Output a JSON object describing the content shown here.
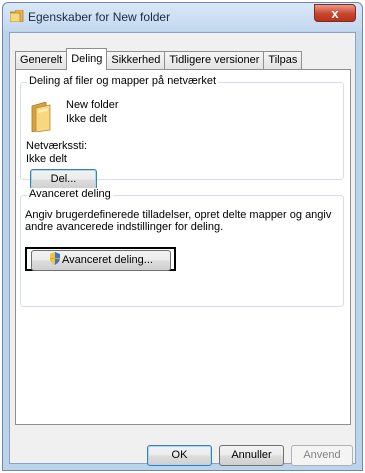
{
  "window": {
    "title": "Egenskaber for New folder",
    "close_glyph": "x"
  },
  "tabs": [
    {
      "label": "Generelt",
      "active": false
    },
    {
      "label": "Deling",
      "active": true
    },
    {
      "label": "Sikkerhed",
      "active": false
    },
    {
      "label": "Tidligere versioner",
      "active": false
    },
    {
      "label": "Tilpas",
      "active": false
    }
  ],
  "network_sharing": {
    "group_title": "Deling af filer og mapper på netværket",
    "folder_name": "New folder",
    "folder_status": "Ikke delt",
    "path_label": "Netværkssti:",
    "path_value": "Ikke delt",
    "share_button": "Del..."
  },
  "advanced_sharing": {
    "group_title": "Avanceret deling",
    "description_line1": "Angiv brugerdefinerede tilladelser, opret delte mapper og angiv",
    "description_line2": "andre avancerede indstillinger for deling.",
    "button_label": "Avanceret deling..."
  },
  "footer": {
    "ok_label": "OK",
    "cancel_label": "Annuller",
    "apply_label": "Anvend"
  },
  "icons": {
    "title": "folder-icon",
    "folder": "folder-icon",
    "advanced_button": "uac-shield-icon"
  },
  "colors": {
    "frame": "#bcd3ec",
    "close_button": "#c9452b",
    "default_button_border": "#3c7fb1"
  }
}
